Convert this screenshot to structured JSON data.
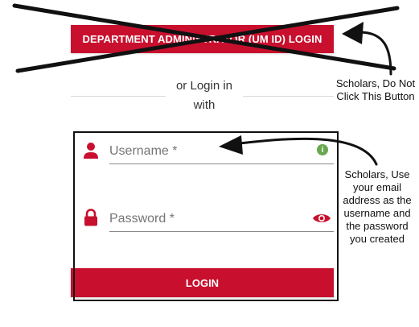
{
  "login_page": {
    "department_button_label": "DEPARTMENT ADMINISTRATOR (UM ID) LOGIN",
    "or_text": "or Login in with",
    "username_label": "Username *",
    "password_label": "Password *",
    "login_button_label": "LOGIN"
  },
  "icons": {
    "user": "user-icon",
    "lock": "lock-icon",
    "field_status": "info-badge-icon",
    "password_visibility": "eye-icon"
  },
  "annotations": {
    "top_note": "Scholars, Do Not Click This Button",
    "side_note": "Scholars, Use your email address as the username and the password you created"
  },
  "colors": {
    "brand_red": "#c8102e",
    "status_green": "#6aa84f",
    "annotation_black": "#111111"
  }
}
